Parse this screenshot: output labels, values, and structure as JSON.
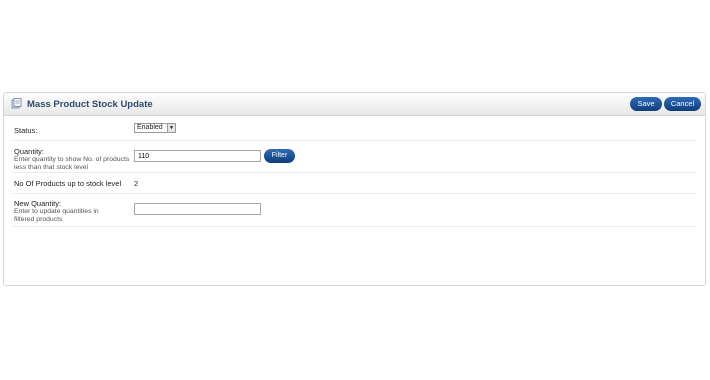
{
  "header": {
    "title": "Mass Product Stock Update",
    "save_label": "Save",
    "cancel_label": "Cancel",
    "icon": "catalog-icon"
  },
  "form": {
    "status": {
      "label": "Status:",
      "value": "Enabled"
    },
    "quantity": {
      "label": "Quantity:",
      "help": "Enter quantity to show No. of products less than that stock level",
      "value": "110",
      "filter_label": "Filter"
    },
    "count": {
      "label": "No Of Products up to stock level",
      "value": "2"
    },
    "new_quantity": {
      "label": "New Quantity:",
      "help": "Enter to update quantities in filtered products",
      "value": ""
    }
  },
  "colors": {
    "accent": "#0f3d7c",
    "title": "#2e4a6e"
  }
}
